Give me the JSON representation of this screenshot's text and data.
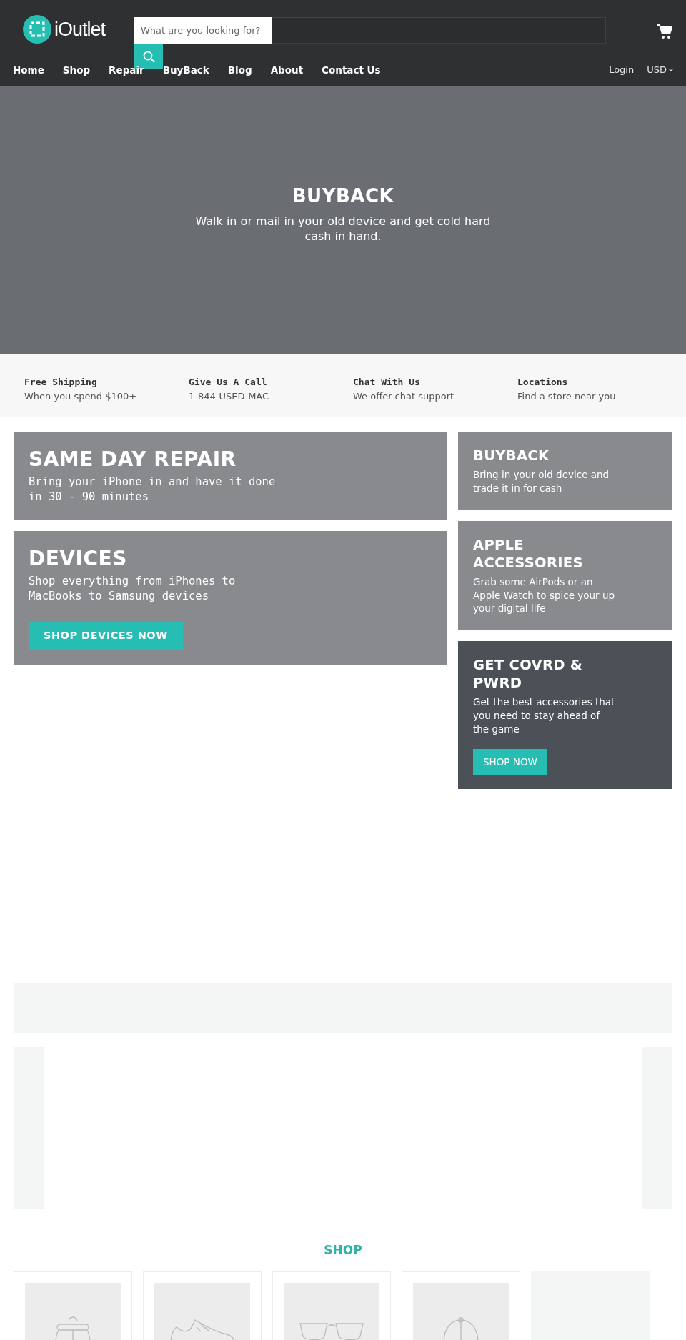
{
  "header": {
    "logo": "iOutlet",
    "search": {
      "placeholder": "What are you looking for?"
    }
  },
  "nav": {
    "items": [
      {
        "label": "Home"
      },
      {
        "label": "Shop"
      },
      {
        "label": "Repair"
      },
      {
        "label": "BuyBack"
      },
      {
        "label": "Blog"
      },
      {
        "label": "About"
      },
      {
        "label": "Contact Us"
      }
    ],
    "login": "Login",
    "currency": "USD"
  },
  "hero": {
    "title": "BUYBACK",
    "subtitle": "Walk in or mail in your old device and get cold hard cash in hand."
  },
  "features": [
    {
      "title": "Free Shipping",
      "text": "When you spend $100+"
    },
    {
      "title": "Give Us A Call",
      "text": "1-844-USED-MAC"
    },
    {
      "title": "Chat With Us",
      "text": "We offer chat support"
    },
    {
      "title": "Locations",
      "text": "Find a store near you"
    }
  ],
  "promos_main": [
    {
      "title": "SAME DAY REPAIR",
      "text": "Bring your iPhone in and have it done in 30 - 90 minutes"
    },
    {
      "title": "DEVICES",
      "text": "Shop everything from iPhones to MacBooks to Samsung devices",
      "button": "SHOP DEVICES NOW"
    }
  ],
  "promos_side": [
    {
      "kind": "light",
      "title": "BUYBACK",
      "text": "Bring in your old device and trade it in for cash"
    },
    {
      "kind": "light",
      "title": "APPLE ACCESSORIES",
      "text": "Grab some AirPods or an Apple Watch to spice your up your digital life"
    },
    {
      "kind": "dark",
      "title": "GET COVRD & PWRD",
      "text": "Get the best accessories that you need to stay ahead of the game",
      "button": "SHOP NOW"
    }
  ],
  "shop": {
    "title": "SHOP",
    "products": [
      {
        "kind": "image"
      },
      {
        "kind": "image"
      },
      {
        "kind": "image"
      },
      {
        "kind": "image"
      },
      {
        "kind": "loading"
      }
    ]
  }
}
